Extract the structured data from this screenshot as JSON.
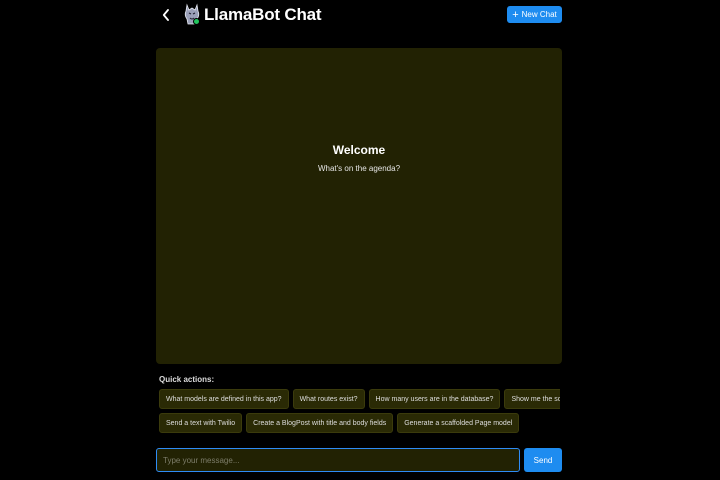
{
  "header": {
    "title": "LlamaBot Chat",
    "back_icon": "chevron-left-icon",
    "avatar_icon": "llama-avatar-icon",
    "status_color": "#22c55e",
    "new_chat_label": "New Chat",
    "new_chat_icon": "plus-icon"
  },
  "chat": {
    "welcome_title": "Welcome",
    "welcome_subtitle": "What's on the agenda?",
    "background_color": "#222203"
  },
  "quick_actions": {
    "label": "Quick actions:",
    "row1": [
      "What models are defined in this app?",
      "What routes exist?",
      "How many users are in the database?",
      "Show me the schema for the"
    ],
    "row2": [
      "Send a text with Twilio",
      "Create a BlogPost with title and body fields",
      "Generate a scaffolded Page model"
    ]
  },
  "composer": {
    "placeholder": "Type your message...",
    "value": "",
    "send_label": "Send"
  },
  "colors": {
    "accent": "#1e8cf0",
    "background": "#000000"
  }
}
